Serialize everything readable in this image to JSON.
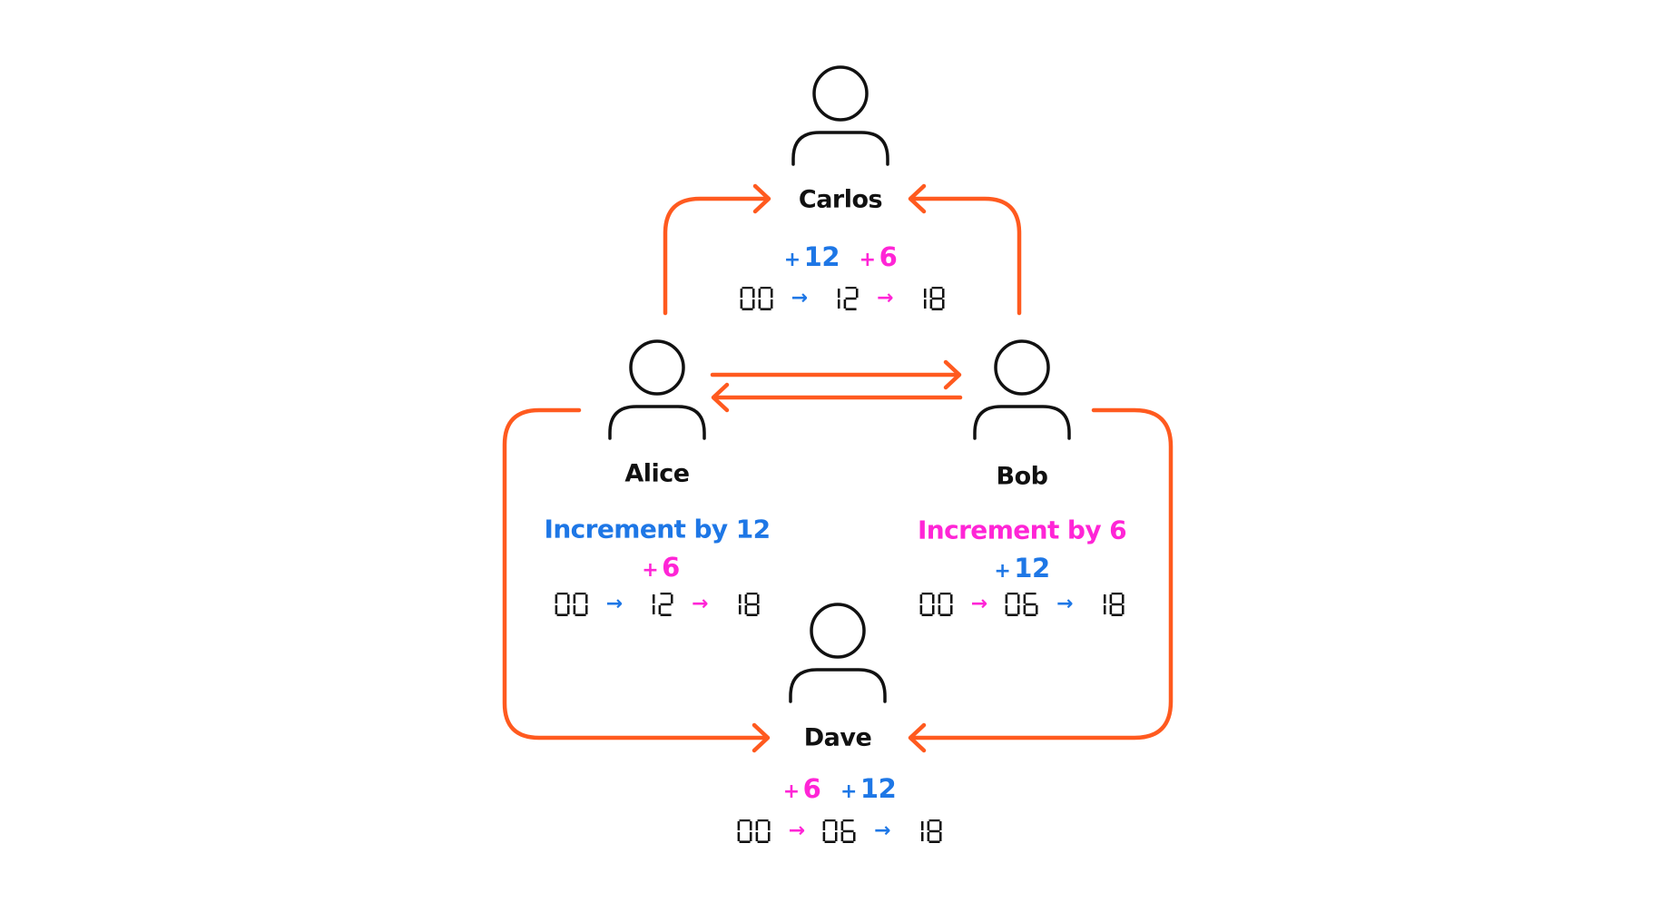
{
  "colors": {
    "connector": "#FF5A1F",
    "blue": "#1E77E6",
    "magenta": "#FF25D6",
    "ink": "#111111"
  },
  "icons": {
    "person": "person-icon",
    "arrow": "arrow-right-icon"
  },
  "nodes": {
    "carlos": {
      "name": "Carlos",
      "ops": [
        {
          "sign": "+",
          "value": "12",
          "color": "blue"
        },
        {
          "sign": "+",
          "value": "6",
          "color": "magenta"
        }
      ],
      "sequence": [
        {
          "value": "00"
        },
        {
          "arrow_color": "blue",
          "value": "12"
        },
        {
          "arrow_color": "magenta",
          "value": "18"
        }
      ]
    },
    "alice": {
      "name": "Alice",
      "instruction": "Increment by 12",
      "instruction_color": "blue",
      "received": {
        "sign": "+",
        "value": "6",
        "color": "magenta"
      },
      "sequence": [
        {
          "value": "00"
        },
        {
          "arrow_color": "blue",
          "value": "12"
        },
        {
          "arrow_color": "magenta",
          "value": "18"
        }
      ]
    },
    "bob": {
      "name": "Bob",
      "instruction": "Increment by 6",
      "instruction_color": "magenta",
      "received": {
        "sign": "+",
        "value": "12",
        "color": "blue"
      },
      "sequence": [
        {
          "value": "00"
        },
        {
          "arrow_color": "magenta",
          "value": "06"
        },
        {
          "arrow_color": "blue",
          "value": "18"
        }
      ]
    },
    "dave": {
      "name": "Dave",
      "ops": [
        {
          "sign": "+",
          "value": "6",
          "color": "magenta"
        },
        {
          "sign": "+",
          "value": "12",
          "color": "blue"
        }
      ],
      "sequence": [
        {
          "value": "00"
        },
        {
          "arrow_color": "magenta",
          "value": "06"
        },
        {
          "arrow_color": "blue",
          "value": "18"
        }
      ]
    }
  },
  "edges": [
    {
      "from": "Alice",
      "to": "Carlos"
    },
    {
      "from": "Bob",
      "to": "Carlos"
    },
    {
      "from": "Alice",
      "to": "Bob"
    },
    {
      "from": "Bob",
      "to": "Alice"
    },
    {
      "from": "Alice",
      "to": "Dave"
    },
    {
      "from": "Bob",
      "to": "Dave"
    }
  ],
  "arrow_glyph": "→"
}
